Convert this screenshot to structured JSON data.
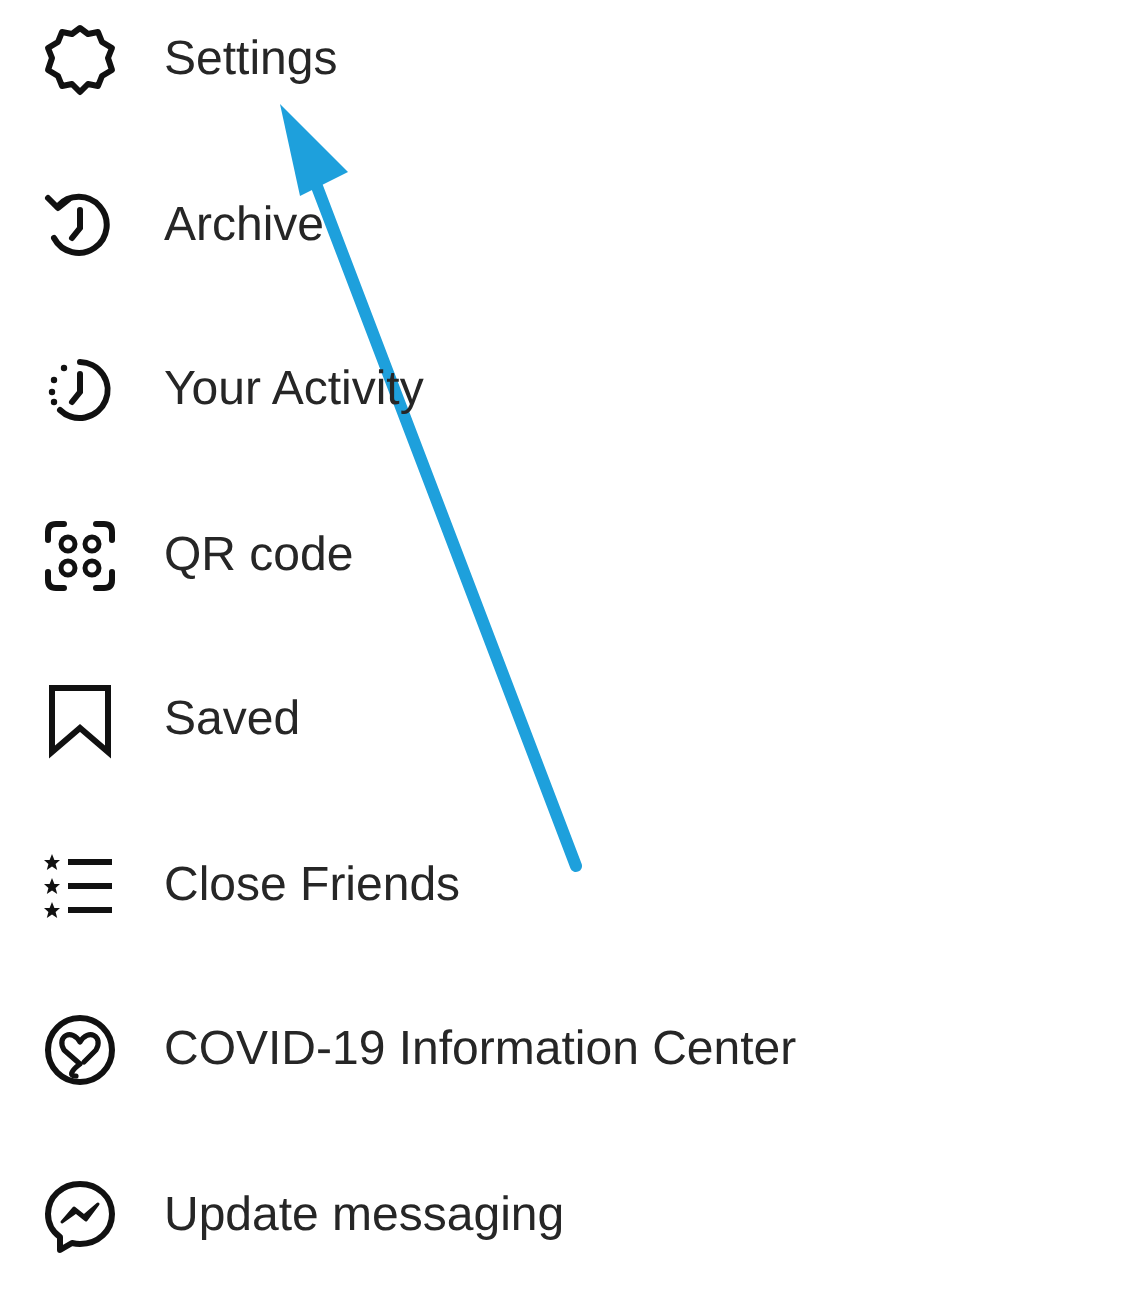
{
  "menu": {
    "items": [
      {
        "label": "Settings"
      },
      {
        "label": "Archive"
      },
      {
        "label": "Your Activity"
      },
      {
        "label": "QR code"
      },
      {
        "label": "Saved"
      },
      {
        "label": "Close Friends"
      },
      {
        "label": "COVID-19 Information Center"
      },
      {
        "label": "Update messaging"
      }
    ]
  }
}
